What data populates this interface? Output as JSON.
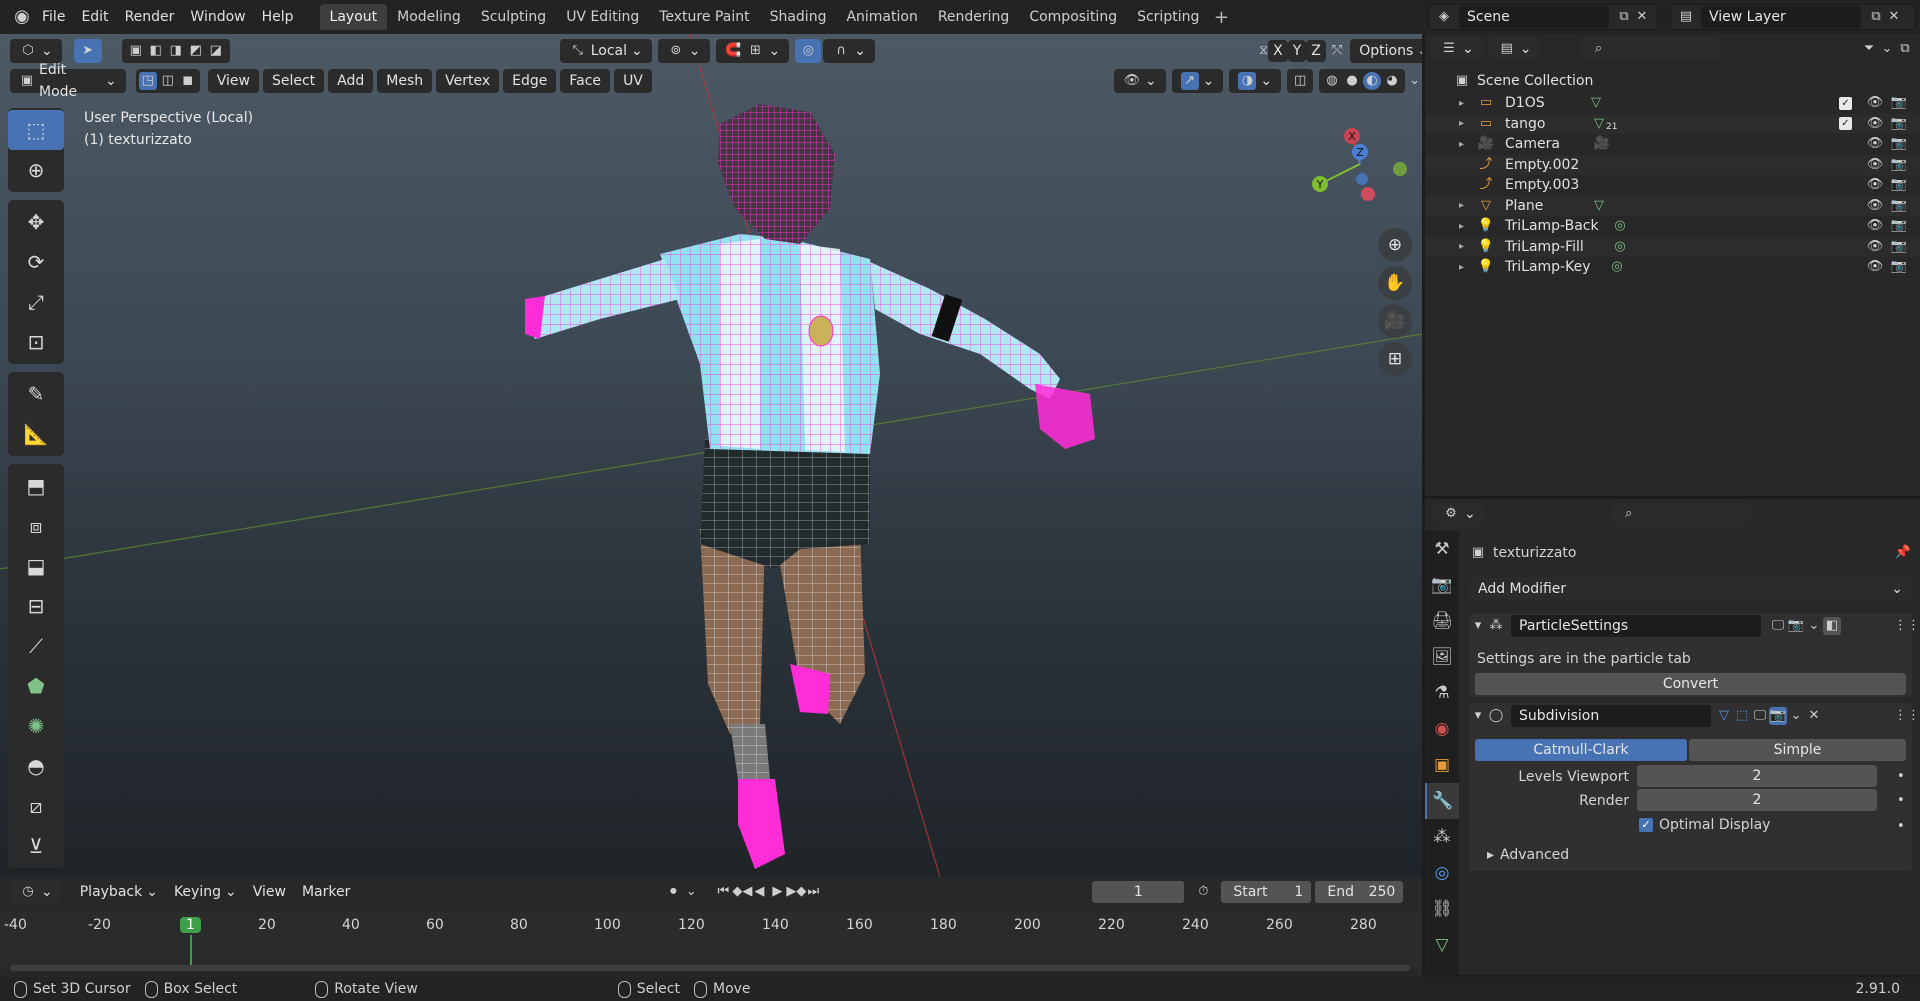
{
  "topbar": {
    "menus": [
      "File",
      "Edit",
      "Render",
      "Window",
      "Help"
    ],
    "workspaces": [
      "Layout",
      "Modeling",
      "Sculpting",
      "UV Editing",
      "Texture Paint",
      "Shading",
      "Animation",
      "Rendering",
      "Compositing",
      "Scripting"
    ],
    "active_workspace": "Layout",
    "scene": "Scene",
    "view_layer": "View Layer"
  },
  "viewport": {
    "orientation": "Local",
    "options_label": "Options",
    "axis_x": "X",
    "axis_y": "Y",
    "axis_z": "Z",
    "mode": "Edit Mode",
    "menus": [
      "View",
      "Select",
      "Add",
      "Mesh",
      "Vertex",
      "Edge",
      "Face",
      "UV"
    ],
    "info_line1": "User Perspective (Local)",
    "info_line2": "(1) texturizzato",
    "gizmo": {
      "x": "X",
      "y": "Y",
      "z": "Z"
    },
    "colors": {
      "wire": "#ff2dd8",
      "grid_x": "#b03a3a",
      "grid_y": "#5b8a2d",
      "accent": "#4772b3"
    }
  },
  "outliner": {
    "root": "Scene Collection",
    "items": [
      {
        "name": "D1OS",
        "icon": "collection-icon",
        "extra": "mesh-icon",
        "checkbox": true
      },
      {
        "name": "tango",
        "icon": "collection-icon",
        "extra": "mesh-icon",
        "badge": "21",
        "checkbox": true
      },
      {
        "name": "Camera",
        "icon": "camera-icon",
        "extra": "camera-data-icon",
        "checkbox": false
      },
      {
        "name": "Empty.002",
        "icon": "empty-icon",
        "extra": "",
        "checkbox": false
      },
      {
        "name": "Empty.003",
        "icon": "empty-icon",
        "extra": "",
        "checkbox": false
      },
      {
        "name": "Plane",
        "icon": "mesh-icon",
        "extra": "mesh-data-icon",
        "checkbox": false
      },
      {
        "name": "TriLamp-Back",
        "icon": "light-icon",
        "extra": "light-data-icon",
        "checkbox": false
      },
      {
        "name": "TriLamp-Fill",
        "icon": "light-icon",
        "extra": "light-data-icon",
        "checkbox": false
      },
      {
        "name": "TriLamp-Key",
        "icon": "light-icon",
        "extra": "light-data-icon",
        "checkbox": false
      }
    ]
  },
  "properties": {
    "object_name": "texturizzato",
    "add_modifier": "Add Modifier",
    "particle": {
      "name": "ParticleSettings",
      "message": "Settings are in the particle tab",
      "convert": "Convert"
    },
    "subdivision": {
      "name": "Subdivision",
      "type_a": "Catmull-Clark",
      "type_b": "Simple",
      "levels_viewport_label": "Levels Viewport",
      "levels_viewport": "2",
      "render_label": "Render",
      "render": "2",
      "optimal_display": "Optimal Display",
      "advanced": "Advanced"
    }
  },
  "timeline": {
    "menus": [
      "Playback",
      "Keying",
      "View",
      "Marker"
    ],
    "current_frame": "1",
    "start_label": "Start",
    "start": "1",
    "end_label": "End",
    "end": "250",
    "ruler": [
      "-40",
      "-20",
      "1",
      "20",
      "40",
      "60",
      "80",
      "100",
      "120",
      "140",
      "160",
      "180",
      "200",
      "220",
      "240",
      "260",
      "280"
    ]
  },
  "status": {
    "hints": [
      "Set 3D Cursor",
      "Box Select",
      "Rotate View",
      "Select",
      "Move"
    ],
    "version": "2.91.0"
  }
}
